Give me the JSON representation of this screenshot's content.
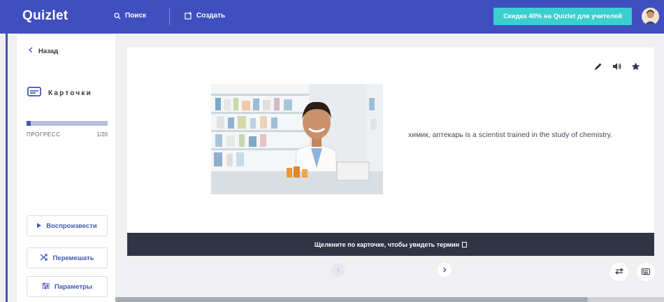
{
  "header": {
    "logo": "Quizlet",
    "search_label": "Поиск",
    "create_label": "Создать",
    "promo_label": "Скидка 40% на Quizlet для учителей",
    "brand_color": "#3f4fbf",
    "promo_color": "#3ccfcf"
  },
  "sidebar": {
    "back_label": "Назад",
    "mode_label": "Карточки",
    "progress": {
      "label": "ПРОГРЕСС",
      "count": "1/20",
      "fraction": 0.05
    },
    "buttons": {
      "play": "Воспроизвести",
      "shuffle": "Перемешать",
      "options": "Параметры"
    }
  },
  "card": {
    "definition": "химик, аптекарь is a scientist trained in the study of chemistry.",
    "icons": [
      "pencil-icon",
      "speaker-icon",
      "star-icon"
    ]
  },
  "hint": {
    "text": "Щелкните по карточке, чтобы увидеть термин"
  }
}
